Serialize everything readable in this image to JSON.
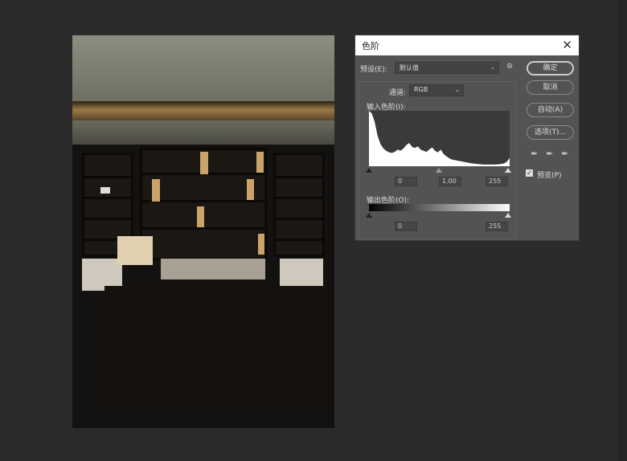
{
  "dialog": {
    "title": "色阶",
    "preset_label": "预设(E):",
    "preset_value": "默认值",
    "channel_label": "通道:",
    "channel_value": "RGB",
    "input_label": "输入色阶(I):",
    "input_black": "0",
    "input_gamma": "1.00",
    "input_white": "255",
    "output_label": "输出色阶(O):",
    "output_black": "0",
    "output_white": "255",
    "ok": "确定",
    "cancel": "取消",
    "auto": "自动(A)",
    "options": "选项(T)...",
    "preview_label": "预览(P)",
    "preview_checked": true
  },
  "histogram": [
    1,
    0.95,
    0.8,
    0.55,
    0.4,
    0.32,
    0.28,
    0.25,
    0.24,
    0.26,
    0.3,
    0.28,
    0.32,
    0.38,
    0.42,
    0.35,
    0.33,
    0.36,
    0.3,
    0.28,
    0.26,
    0.3,
    0.34,
    0.28,
    0.25,
    0.3,
    0.22,
    0.18,
    0.14,
    0.12,
    0.11,
    0.1,
    0.09,
    0.08,
    0.07,
    0.06,
    0.05,
    0.045,
    0.04,
    0.035,
    0.03,
    0.03,
    0.03,
    0.03,
    0.03,
    0.035,
    0.04,
    0.05,
    0.08,
    0.15
  ]
}
